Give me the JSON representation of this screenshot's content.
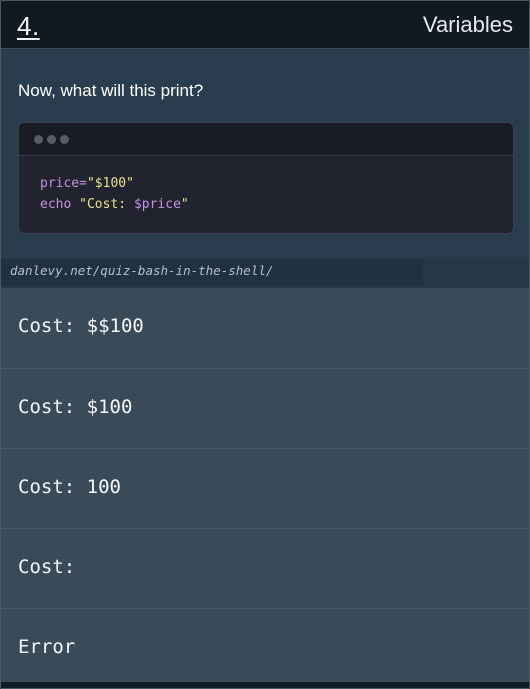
{
  "question": {
    "number": "4.",
    "title": "Variables",
    "prompt": "Now, what will this print?"
  },
  "code": {
    "line1": {
      "var": "price",
      "op": "=",
      "value": "\"$100\""
    },
    "line2": {
      "cmd": "echo",
      "str_open": "\"Cost: ",
      "interp": "$price",
      "str_close": "\""
    }
  },
  "source_url": "danlevy.net/quiz-bash-in-the-shell/",
  "options": [
    {
      "label": "Cost: $$100"
    },
    {
      "label": "Cost: $100"
    },
    {
      "label": "Cost: 100"
    },
    {
      "label": "Cost:"
    },
    {
      "label": "Error"
    }
  ]
}
